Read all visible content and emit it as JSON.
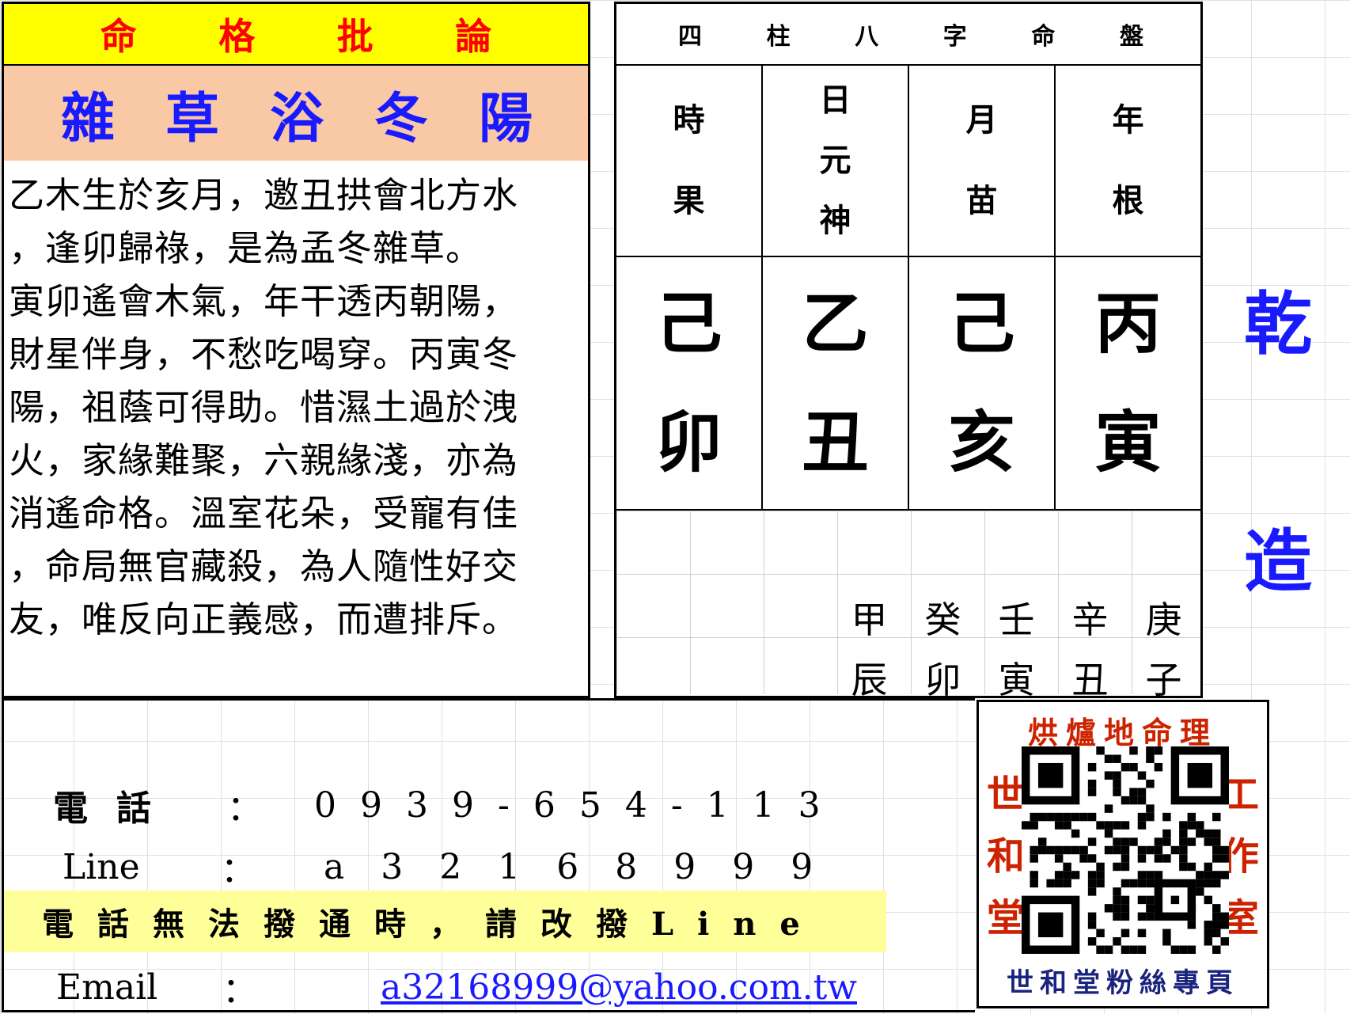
{
  "analysis": {
    "header": [
      "命",
      "格",
      "批",
      "論"
    ],
    "title": [
      "雜",
      "草",
      "浴",
      "冬",
      "陽"
    ],
    "lines": [
      "乙木生於亥月，邀丑拱會北方水",
      "，逢卯歸祿，是為孟冬雜草。",
      "寅卯遙會木氣，年干透丙朝陽，",
      "財星伴身，不愁吃喝穿。丙寅冬",
      "陽，祖蔭可得助。惜濕土過於洩",
      "火，家緣難聚，六親緣淺，亦為",
      "消遙命格。溫室花朵，受寵有佳",
      "，命局無官藏殺，為人隨性好交",
      "友，唯反向正義感，而遭排斥。"
    ]
  },
  "chart": {
    "title": [
      "四",
      "柱",
      "八",
      "字",
      "命",
      "盤"
    ],
    "labels": [
      {
        "top": "時",
        "bottom": "果"
      },
      {
        "top": "日",
        "mid": "元",
        "bottom": "神"
      },
      {
        "top": "月",
        "bottom": "苗"
      },
      {
        "top": "年",
        "bottom": "根"
      }
    ],
    "pillars": [
      {
        "stem": "己",
        "branch": "卯"
      },
      {
        "stem": "乙",
        "branch": "丑"
      },
      {
        "stem": "己",
        "branch": "亥"
      },
      {
        "stem": "丙",
        "branch": "寅"
      }
    ],
    "luck": [
      {
        "stem": "甲",
        "branch": "辰"
      },
      {
        "stem": "癸",
        "branch": "卯"
      },
      {
        "stem": "壬",
        "branch": "寅"
      },
      {
        "stem": "辛",
        "branch": "丑"
      },
      {
        "stem": "庚",
        "branch": "子"
      }
    ]
  },
  "gender": [
    "乾",
    "造"
  ],
  "contact": {
    "phone_label": "電話",
    "phone_colon": "：",
    "phone_value": "0939-654-113",
    "line_label": "Line",
    "line_colon": "：",
    "line_value": "a32168999",
    "notice": "電話無法撥通時，請改撥Line",
    "email_label": "Email",
    "email_colon": "：",
    "email_value": "a32168999@yahoo.com.tw"
  },
  "qr": {
    "top_text": "烘爐地命理",
    "left_text": [
      "世",
      "和",
      "堂"
    ],
    "right_text": [
      "工",
      "作",
      "室"
    ],
    "bottom_text": "世和堂粉絲專頁",
    "color_red": "#cc2200",
    "color_navy": "#1a237e"
  },
  "colors": {
    "header_bg": "#ffff00",
    "header_text": "#ff0000",
    "subtitle_bg": "#f9c9a6",
    "subtitle_text": "#1a1aff",
    "notice_bg": "#ffff99",
    "link": "#1a1aff"
  }
}
